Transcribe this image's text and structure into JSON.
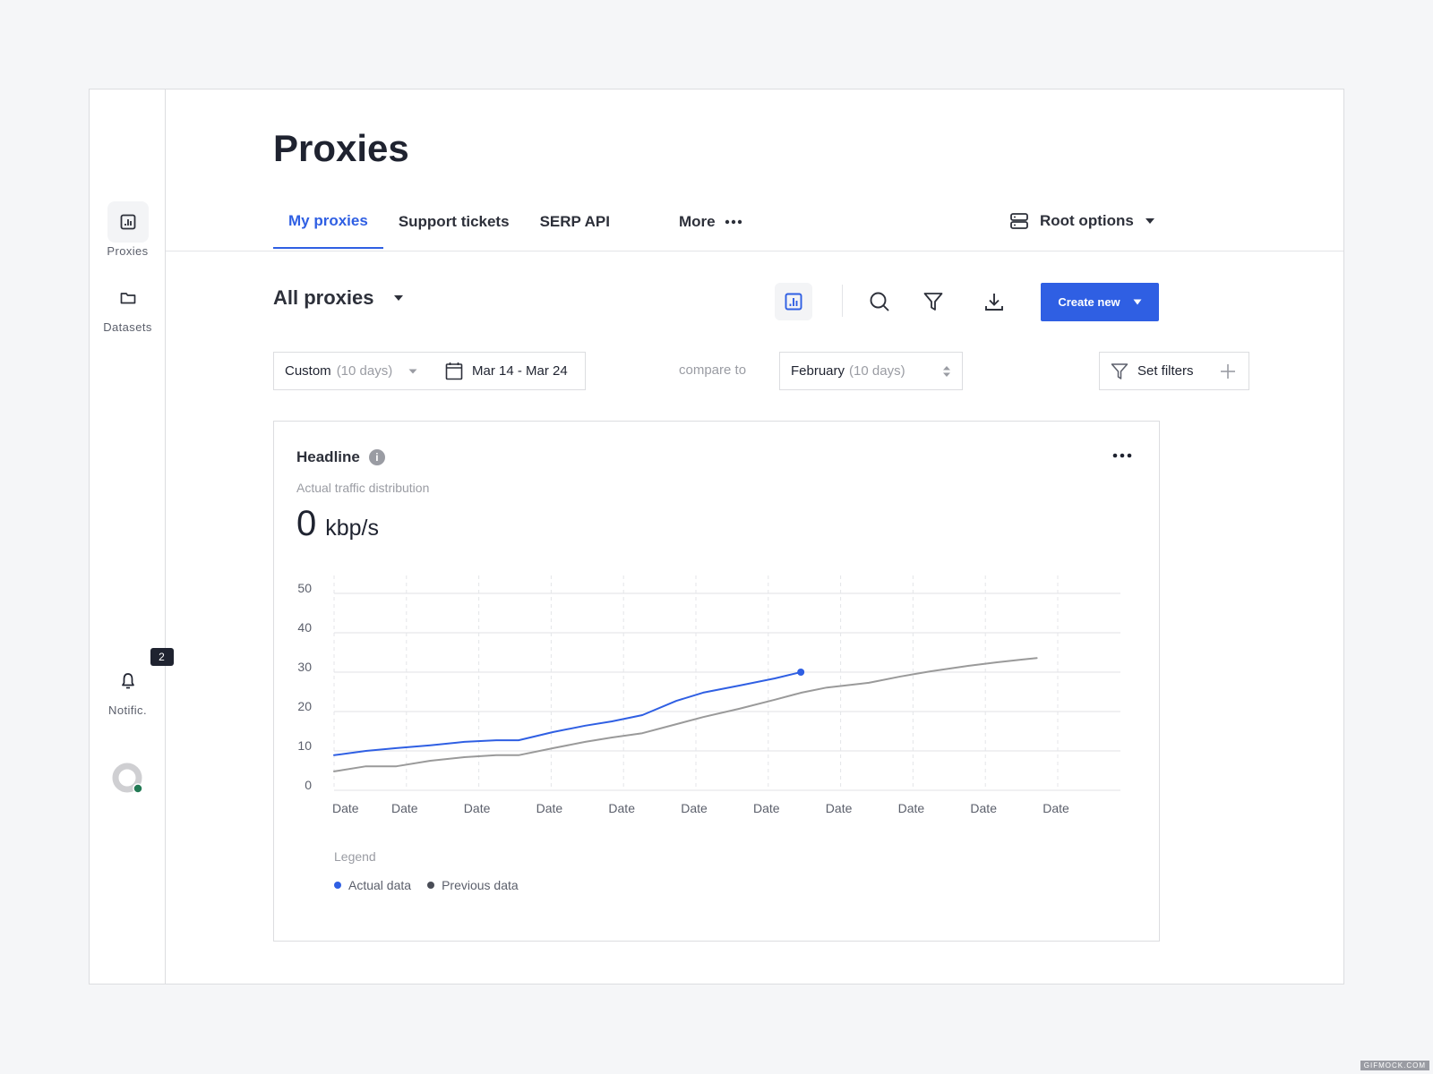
{
  "sidebar": {
    "items": [
      {
        "label": "Proxies",
        "icon": "bar-chart-icon",
        "active": true
      },
      {
        "label": "Datasets",
        "icon": "folder-icon",
        "active": false
      },
      {
        "label": "Notific.",
        "icon": "bell-icon",
        "badge": "2"
      }
    ],
    "avatar_status_color": "#237a55"
  },
  "header": {
    "title": "Proxies",
    "tabs": [
      {
        "label": "My proxies",
        "active": true
      },
      {
        "label": "Support tickets",
        "active": false
      },
      {
        "label": "SERP API",
        "active": false
      },
      {
        "label": "More",
        "active": false
      }
    ],
    "root_options_label": "Root options"
  },
  "toolbar": {
    "view_selector_label": "All proxies",
    "icons": [
      "chart-view-icon",
      "search-icon",
      "filter-icon",
      "download-icon"
    ],
    "create_label": "Create new",
    "accent_color": "#2f5fe3"
  },
  "filters": {
    "range_preset": "Custom",
    "range_preset_hint": "(10 days)",
    "date_range": "Mar 14 - Mar 24",
    "compare_to_label": "compare to",
    "compare_period": "February",
    "compare_period_hint": "(10 days)",
    "set_filters_label": "Set filters"
  },
  "card": {
    "title": "Headline",
    "subtitle": "Actual traffic distribution",
    "metric_value": "0",
    "metric_unit": "kbp/s",
    "legend_title": "Legend"
  },
  "chart_data": {
    "type": "line",
    "title": "Headline",
    "subtitle": "Actual traffic distribution",
    "xlabel": "",
    "ylabel": "",
    "ylim": [
      0,
      50
    ],
    "yticks": [
      0,
      10,
      20,
      30,
      40,
      50
    ],
    "x_tick_labels": [
      "Date",
      "Date",
      "Date",
      "Date",
      "Date",
      "Date",
      "Date",
      "Date",
      "Date",
      "Date",
      "Date"
    ],
    "x_range": [
      0,
      10.9
    ],
    "grid": true,
    "legend_position": "bottom-left",
    "series": [
      {
        "name": "Actual data",
        "color": "#2f5fe3",
        "end_marker": true,
        "x": [
          0,
          0.44,
          0.86,
          1.33,
          1.8,
          2.24,
          2.55,
          3.03,
          3.47,
          3.84,
          4.26,
          4.73,
          5.1,
          5.6,
          6.09,
          6.45
        ],
        "y": [
          8.9,
          10,
          10.7,
          11.4,
          12.3,
          12.7,
          12.7,
          14.8,
          16.4,
          17.5,
          19.1,
          22.7,
          24.8,
          26.6,
          28.4,
          30
        ]
      },
      {
        "name": "Previous data",
        "color": "#9a9a9a",
        "legend_color": "#4a4d57",
        "end_marker": false,
        "x": [
          0,
          0.44,
          0.86,
          1.33,
          1.8,
          2.24,
          2.55,
          3.03,
          3.47,
          3.84,
          4.26,
          4.73,
          5.1,
          5.6,
          6.09,
          6.46,
          6.81,
          7.39,
          7.83,
          8.24,
          8.76,
          9.16,
          9.71
        ],
        "y": [
          4.8,
          6.1,
          6.1,
          7.5,
          8.4,
          8.9,
          8.9,
          10.7,
          12.3,
          13.4,
          14.5,
          16.8,
          18.6,
          20.7,
          23,
          24.8,
          26.1,
          27.3,
          28.9,
          30.2,
          31.6,
          32.5,
          33.6
        ]
      }
    ]
  },
  "watermark": "GIFMOCK.COM"
}
